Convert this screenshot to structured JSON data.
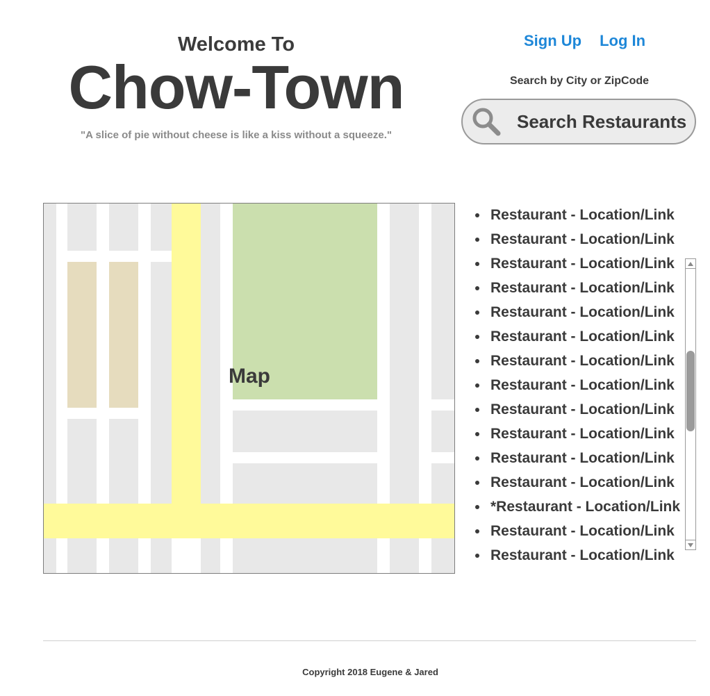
{
  "header": {
    "welcome": "Welcome To",
    "brand": "Chow-Town",
    "quote": "\"A slice of pie without cheese is like a kiss without a squeeze.\""
  },
  "auth": {
    "sign_up": "Sign Up",
    "log_in": "Log In"
  },
  "search": {
    "label": "Search by City or ZipCode",
    "button": "Search Restaurants",
    "icon": "search-icon"
  },
  "map": {
    "label": "Map"
  },
  "restaurants": [
    "Restaurant - Location/Link",
    "Restaurant - Location/Link",
    "Restaurant - Location/Link",
    "Restaurant - Location/Link",
    "Restaurant - Location/Link",
    "Restaurant - Location/Link",
    "Restaurant - Location/Link",
    "Restaurant - Location/Link",
    "Restaurant - Location/Link",
    "Restaurant - Location/Link",
    "Restaurant - Location/Link",
    "Restaurant - Location/Link",
    "*Restaurant - Location/Link",
    "Restaurant - Location/Link",
    "Restaurant - Location/Link"
  ],
  "footer": {
    "copyright": "Copyright 2018 Eugene & Jared"
  },
  "colors": {
    "link": "#1e87d8",
    "road": "#fffa9a",
    "park": "#cbdfae",
    "block": "#e8e8e8",
    "tan_block": "#e6dcbe"
  }
}
